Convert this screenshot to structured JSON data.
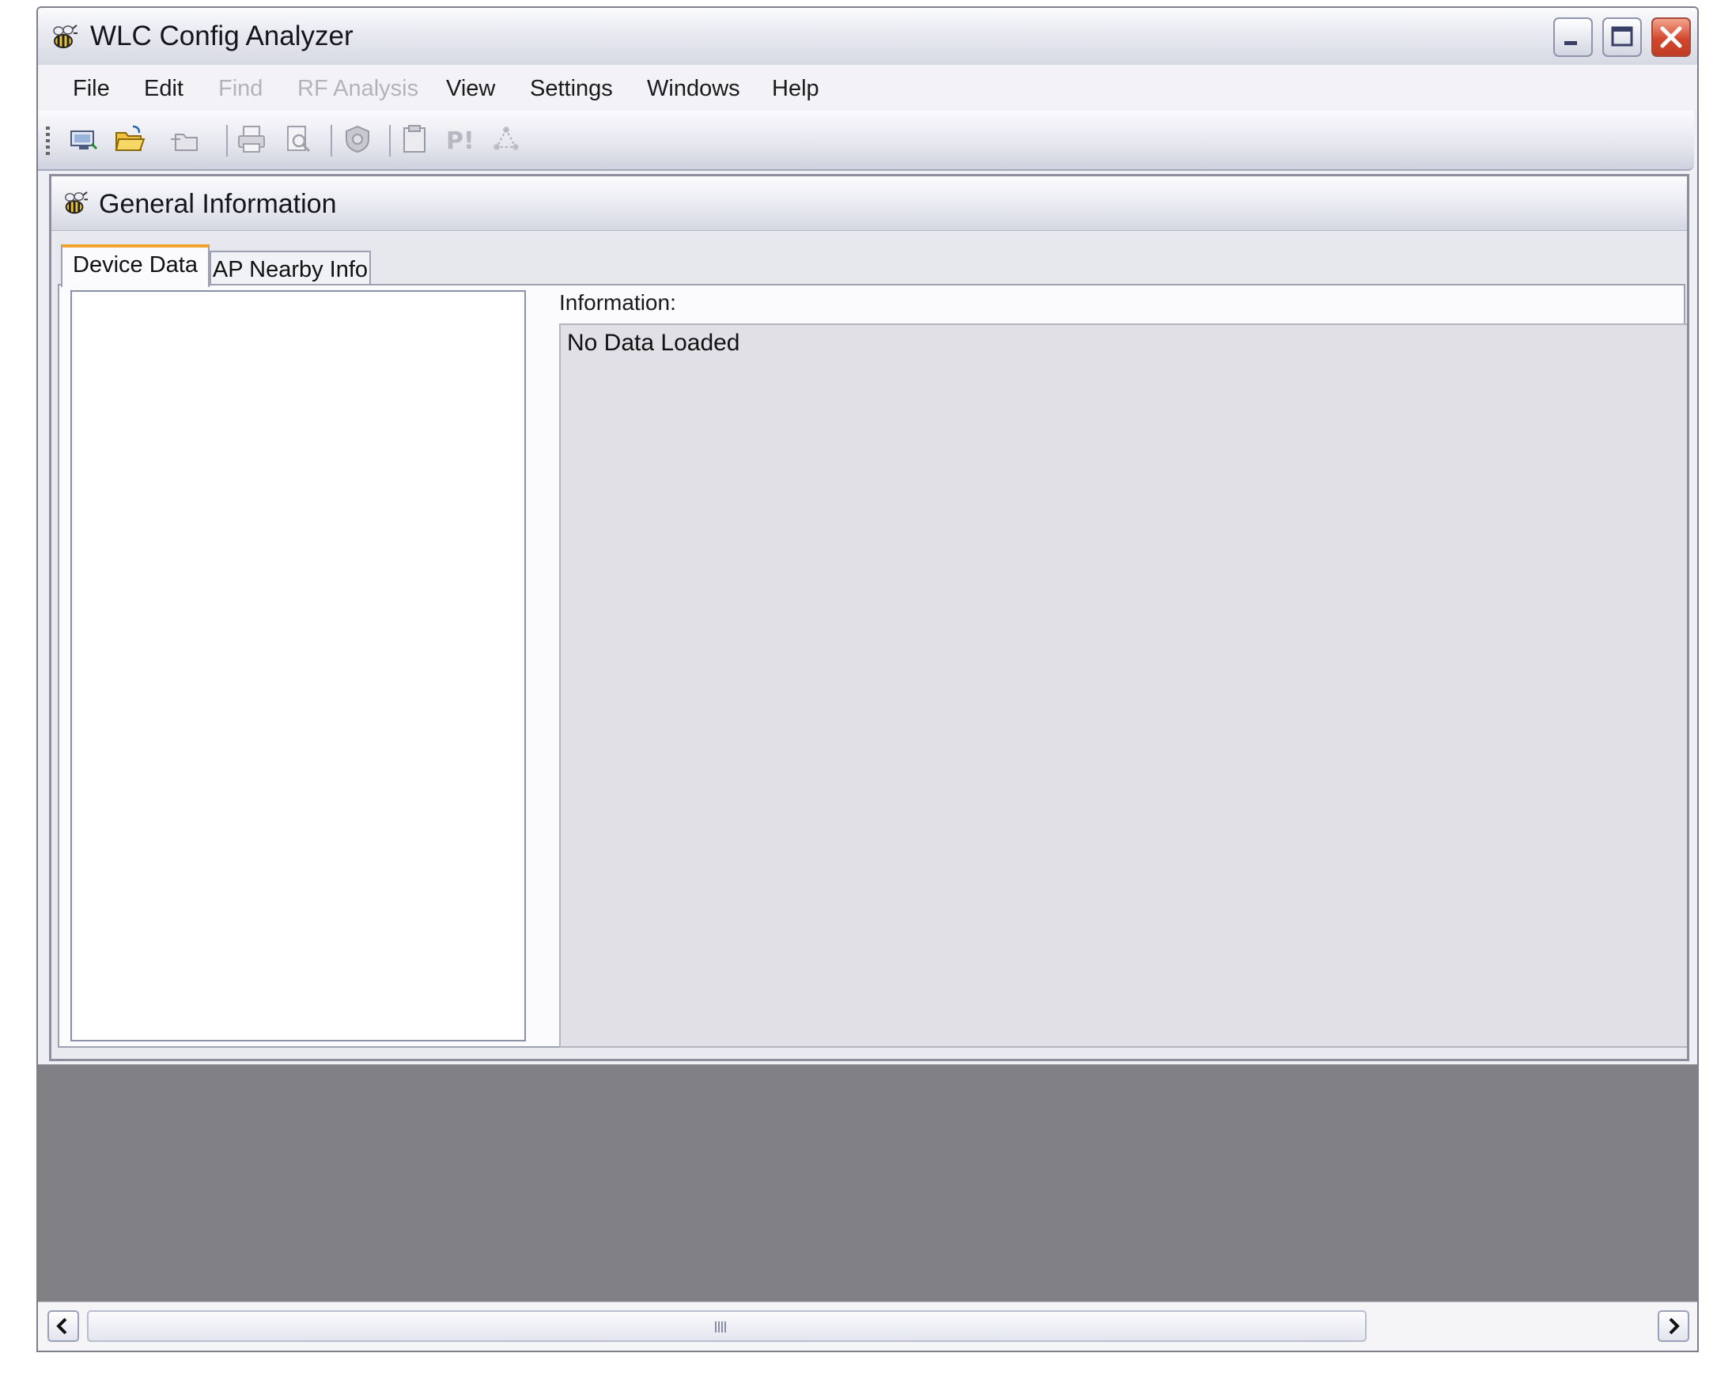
{
  "window": {
    "title": "WLC Config Analyzer",
    "app_icon": "bee-icon",
    "controls": [
      "minimize-icon",
      "maximize-icon",
      "close-icon"
    ]
  },
  "menu": {
    "items": [
      {
        "label": "File",
        "enabled": true
      },
      {
        "label": "Edit",
        "enabled": true
      },
      {
        "label": "Find",
        "enabled": false
      },
      {
        "label": "RF Analysis",
        "enabled": false
      },
      {
        "label": "View",
        "enabled": true
      },
      {
        "label": "Settings",
        "enabled": true
      },
      {
        "label": "Windows",
        "enabled": true
      },
      {
        "label": "Help",
        "enabled": true
      }
    ]
  },
  "toolbar": {
    "icons": [
      "new-icon",
      "open-folder-icon",
      "add-folder-icon",
      "print-icon",
      "print-preview-icon",
      "shield-icon",
      "clipboard-icon",
      "p-exclamation-icon",
      "network-icon"
    ]
  },
  "child_window": {
    "title": "General Information",
    "icon": "bee-icon",
    "tabs": [
      {
        "label": "Device Data",
        "active": true
      },
      {
        "label": "AP Nearby Info",
        "active": false
      }
    ],
    "info_label": "Information:",
    "info_text": "No Data Loaded"
  },
  "colors": {
    "active_tab_accent": "#f2a12a",
    "mdi_background": "#818085",
    "close_button": "#d2482f"
  }
}
